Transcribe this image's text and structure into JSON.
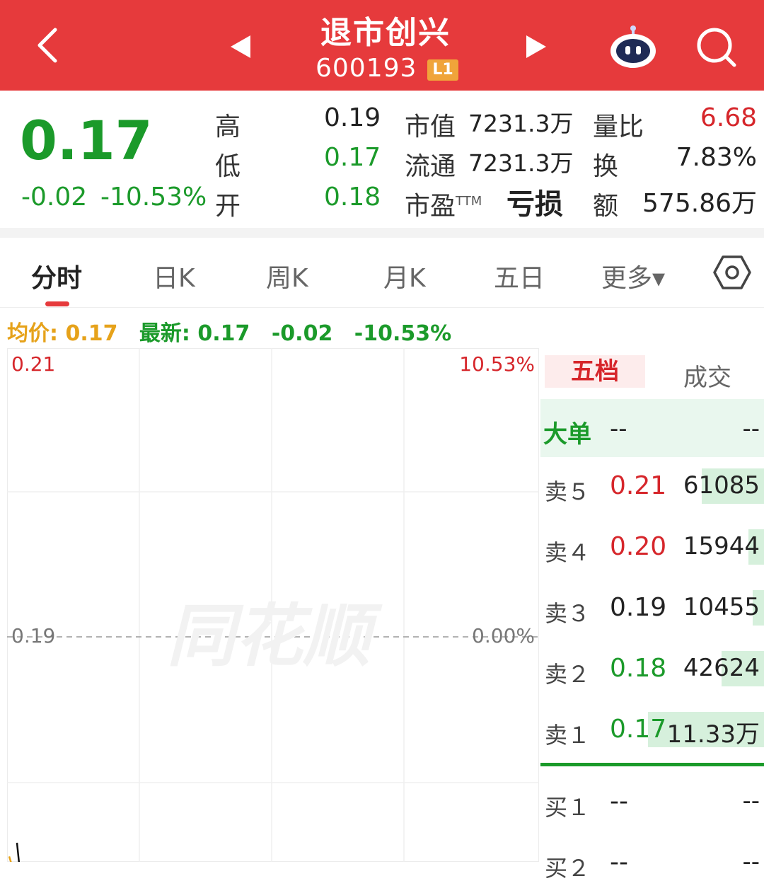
{
  "header": {
    "title": "退市创兴",
    "code": "600193",
    "level_badge": "L1",
    "colors": {
      "bar": "#e63a3c",
      "badge": "#f0a43a"
    },
    "icons": [
      "back-arrow-icon",
      "prev-stock-icon",
      "next-stock-icon",
      "robot-assistant-icon",
      "search-icon"
    ]
  },
  "quote": {
    "price": "0.17",
    "change": "-0.02",
    "change_pct": "-10.53%",
    "fields": {
      "high_label": "高",
      "high": "0.19",
      "low_label": "低",
      "low": "0.17",
      "open_label": "开",
      "open": "0.18",
      "mktcap_label": "市值",
      "mktcap": "7231.3万",
      "float_label": "流通",
      "float": "7231.3万",
      "pe_label": "市盈",
      "pe_sup": "TTM",
      "pe": "亏损",
      "volratio_label": "量比",
      "volratio": "6.68",
      "turnover_label": "换",
      "turnover": "7.83%",
      "amount_label": "额",
      "amount": "575.86万"
    },
    "colors": {
      "down": "#1b9a2a",
      "up": "#d6262b"
    }
  },
  "tabs": {
    "items": [
      "分时",
      "日K",
      "周K",
      "月K",
      "五日",
      "更多▾"
    ],
    "active_index": 0
  },
  "legend": {
    "avg_label": "均价: 0.17",
    "latest_label": "最新: 0.17",
    "change": "-0.02",
    "change_pct": "-10.53%"
  },
  "chart_data": {
    "type": "line",
    "y_ticks_left": [
      "0.21",
      "0.19"
    ],
    "y_ticks_right": [
      "10.53%",
      "0.00%"
    ],
    "ylim": [
      0.17,
      0.21
    ],
    "reference_price": 0.19,
    "watermark": "同花顺",
    "series": [
      {
        "values": [
          0.175,
          0.172,
          0.171,
          0.17,
          0.17
        ]
      },
      {
        "values": [
          0.174,
          0.173,
          0.172,
          0.171
        ]
      }
    ]
  },
  "orderbook": {
    "tabs": [
      "五档",
      "成交"
    ],
    "active_tab": 0,
    "big_order": {
      "label": "大单",
      "mid": "--",
      "right": "--"
    },
    "asks": [
      {
        "label": "卖５",
        "price": "0.21",
        "volume": "61085",
        "color": "red",
        "fill": 0.28
      },
      {
        "label": "卖４",
        "price": "0.20",
        "volume": "15944",
        "color": "red",
        "fill": 0.07
      },
      {
        "label": "卖３",
        "price": "0.19",
        "volume": "10455",
        "color": "dark",
        "fill": 0.05
      },
      {
        "label": "卖２",
        "price": "0.18",
        "volume": "42624",
        "color": "green",
        "fill": 0.19
      },
      {
        "label": "卖１",
        "price": "0.17",
        "volume": "11.33万",
        "color": "green",
        "fill": 0.52
      }
    ],
    "bids": [
      {
        "label": "买１",
        "price": "--",
        "volume": "--"
      },
      {
        "label": "买２",
        "price": "--",
        "volume": "--"
      }
    ]
  }
}
